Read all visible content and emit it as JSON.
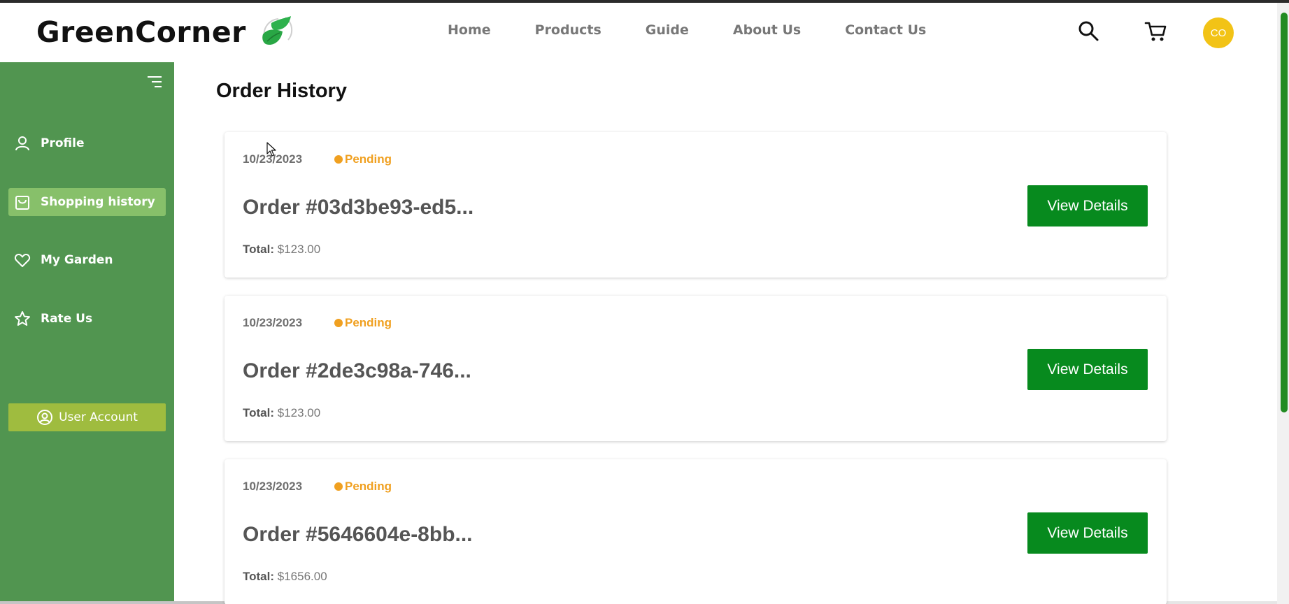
{
  "brand": {
    "name": "GreenCorner",
    "logo_icon": "leaf-logo-icon"
  },
  "nav": {
    "links": [
      "Home",
      "Products",
      "Guide",
      "About Us",
      "Contact Us"
    ],
    "search_icon": "search-icon",
    "cart_icon": "cart-icon",
    "avatar_initials": "CO"
  },
  "sidebar": {
    "menu_icon": "hamburger-menu-icon",
    "items": [
      {
        "label": "Profile",
        "icon": "user-icon",
        "active": false
      },
      {
        "label": "Shopping history",
        "icon": "shopping-bag-icon",
        "active": true
      },
      {
        "label": "My Garden",
        "icon": "heart-icon",
        "active": false
      },
      {
        "label": "Rate Us",
        "icon": "star-icon",
        "active": false
      }
    ],
    "account_button": {
      "label": "User Account",
      "icon": "user-circle-icon"
    }
  },
  "main": {
    "title": "Order History",
    "orders": [
      {
        "date": "10/23/2023",
        "status": "Pending",
        "title": "Order #03d3be93-ed5...",
        "total_label": "Total:",
        "total_value": "$123.00",
        "button": "View Details"
      },
      {
        "date": "10/23/2023",
        "status": "Pending",
        "title": "Order #2de3c98a-746...",
        "total_label": "Total:",
        "total_value": "$123.00",
        "button": "View Details"
      },
      {
        "date": "10/23/2023",
        "status": "Pending",
        "title": "Order #5646604e-8bb...",
        "total_label": "Total:",
        "total_value": "$1656.00",
        "button": "View Details"
      }
    ]
  },
  "colors": {
    "sidebar": "#519550",
    "sidebar_active": "#87c06a",
    "account_button": "#9fbc3f",
    "primary_button": "#078a1e",
    "status_pending": "#f0a020",
    "avatar": "#f2c316",
    "scrollbar": "#228b22"
  }
}
